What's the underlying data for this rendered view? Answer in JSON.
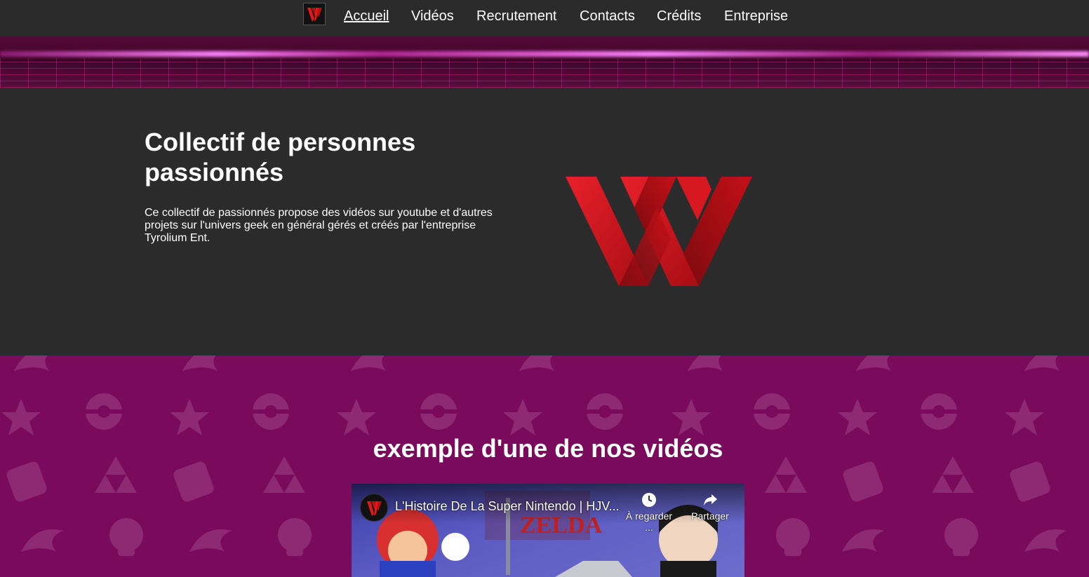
{
  "nav": {
    "items": [
      {
        "label": "Accueil",
        "active": true
      },
      {
        "label": "Vidéos"
      },
      {
        "label": "Recrutement"
      },
      {
        "label": "Contacts"
      },
      {
        "label": "Crédits"
      },
      {
        "label": "Entreprise"
      }
    ]
  },
  "hero": {
    "title": "Collectif de personnes passionnés",
    "description": "Ce collectif de passionnés propose des vidéos sur youtube et d'autres projets sur l'univers geek en général gérés et créés par l'entreprise Tyrolium Ent."
  },
  "videos": {
    "title": "exemple d'une de nos vidéos",
    "player": {
      "video_title": "L'Histoire De La Super Nintendo | HJV...",
      "watch_later_label": "À regarder ...",
      "share_label": "Partager"
    }
  },
  "colors": {
    "nav_bg": "#2b2b2b",
    "hero_bg": "#2b2b2b",
    "videos_bg": "#7a0a5c",
    "logo_red": "#d4141e",
    "banner_glow": "#ff7cff"
  }
}
